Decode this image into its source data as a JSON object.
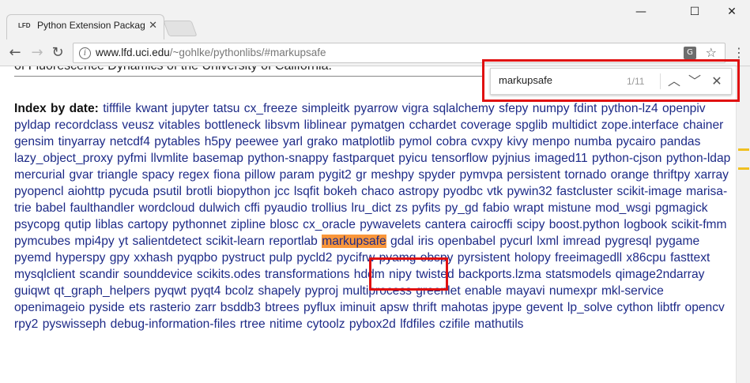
{
  "tab": {
    "favicon_text": "LFD",
    "title": "Python Extension Packag",
    "close": "✕"
  },
  "window_controls": {
    "minimize": "—",
    "maximize": "☐",
    "close": "✕"
  },
  "address": {
    "host": "www.lfd.uci.edu",
    "path": "/~gohlke/pythonlibs/#markupsafe"
  },
  "page": {
    "cut_text": "of Fluorescence Dynamics of the University of California.",
    "index_label": "Index by date:",
    "packages": [
      "tifffile",
      "kwant",
      "jupyter",
      "tatsu",
      "cx_freeze",
      "simpleitk",
      "pyarrow",
      "vigra",
      "sqlalchemy",
      "sfepy",
      "numpy",
      "fdint",
      "python-lz4",
      "openpiv",
      "pyldap",
      "recordclass",
      "veusz",
      "vitables",
      "bottleneck",
      "libsvm",
      "liblinear",
      "pymatgen",
      "cchardet",
      "coverage",
      "spglib",
      "multidict",
      "zope.interface",
      "chainer",
      "gensim",
      "tinyarray",
      "netcdf4",
      "pytables",
      "h5py",
      "peewee",
      "yarl",
      "grako",
      "matplotlib",
      "pymol",
      "cobra",
      "cvxpy",
      "kivy",
      "menpo",
      "numba",
      "pycairo",
      "pandas",
      "lazy_object_proxy",
      "pyfmi",
      "llvmlite",
      "basemap",
      "python-snappy",
      "fastparquet",
      "pyicu",
      "tensorflow",
      "pyjnius",
      "imaged11",
      "python-cjson",
      "python-ldap",
      "mercurial",
      "gvar",
      "triangle",
      "spacy",
      "regex",
      "fiona",
      "pillow",
      "param",
      "pygit2",
      "gr",
      "meshpy",
      "spyder",
      "pymvpa",
      "persistent",
      "tornado",
      "orange",
      "thriftpy",
      "xarray",
      "pyopencl",
      "aiohttp",
      "pycuda",
      "psutil",
      "brotli",
      "biopython",
      "jcc",
      "lsqfit",
      "bokeh",
      "chaco",
      "astropy",
      "pyodbc",
      "vtk",
      "pywin32",
      "fastcluster",
      "scikit-image",
      "marisa-trie",
      "babel",
      "faulthandler",
      "wordcloud",
      "dulwich",
      "cffi",
      "pyaudio",
      "trollius",
      "lru_dict",
      "zs",
      "pyfits",
      "py_gd",
      "fabio",
      "wrapt",
      "mistune",
      "mod_wsgi",
      "pgmagick",
      "psycopg",
      "qutip",
      "liblas",
      "cartopy",
      "pythonnet",
      "zipline",
      "blosc",
      "cx_oracle",
      "pywavelets",
      "cantera",
      "cairocffi",
      "scipy",
      "boost.python",
      "logbook",
      "scikit-fmm",
      "pymcubes",
      "mpi4py",
      "yt",
      "salientdetect",
      "scikit-learn",
      "reportlab",
      "markupsafe",
      "gdal",
      "iris",
      "openbabel",
      "pycurl",
      "lxml",
      "imread",
      "pygresql",
      "pygame",
      "pyemd",
      "hyperspy",
      "gpy",
      "xxhash",
      "pyqpbo",
      "pystruct",
      "pulp",
      "pycld2",
      "pycifrw",
      "pyamg",
      "obspy",
      "pyrsistent",
      "holopy",
      "freeimagedll",
      "x86cpu",
      "fasttext",
      "mysqlclient",
      "scandir",
      "sounddevice",
      "scikits.odes",
      "transformations",
      "hddm",
      "nipy",
      "twisted",
      "backports.lzma",
      "statsmodels",
      "qimage2ndarray",
      "guiqwt",
      "qt_graph_helpers",
      "pyqwt",
      "pyqt4",
      "bcolz",
      "shapely",
      "pyproj",
      "multiprocess",
      "greenlet",
      "enable",
      "mayavi",
      "numexpr",
      "mkl-service",
      "openimageio",
      "pyside",
      "ets",
      "rasterio",
      "zarr",
      "bsddb3",
      "btrees",
      "pyflux",
      "iminuit",
      "apsw",
      "thrift",
      "mahotas",
      "jpype",
      "gevent",
      "lp_solve",
      "cython",
      "libtfr",
      "opencv",
      "rpy2",
      "pyswisseph",
      "debug-information-files",
      "rtree",
      "nitime",
      "cytoolz",
      "pybox2d",
      "lfdfiles",
      "czifile",
      "mathutils"
    ],
    "highlighted": "markupsafe"
  },
  "find_bar": {
    "query": "markupsafe",
    "count": "1/11",
    "prev": "︿",
    "next": "﹀",
    "close": "✕"
  },
  "colors": {
    "highlight": "#f9963a",
    "link": "#1d2a87",
    "annotation": "#e01010",
    "scroll_marker": "#f0c020"
  }
}
